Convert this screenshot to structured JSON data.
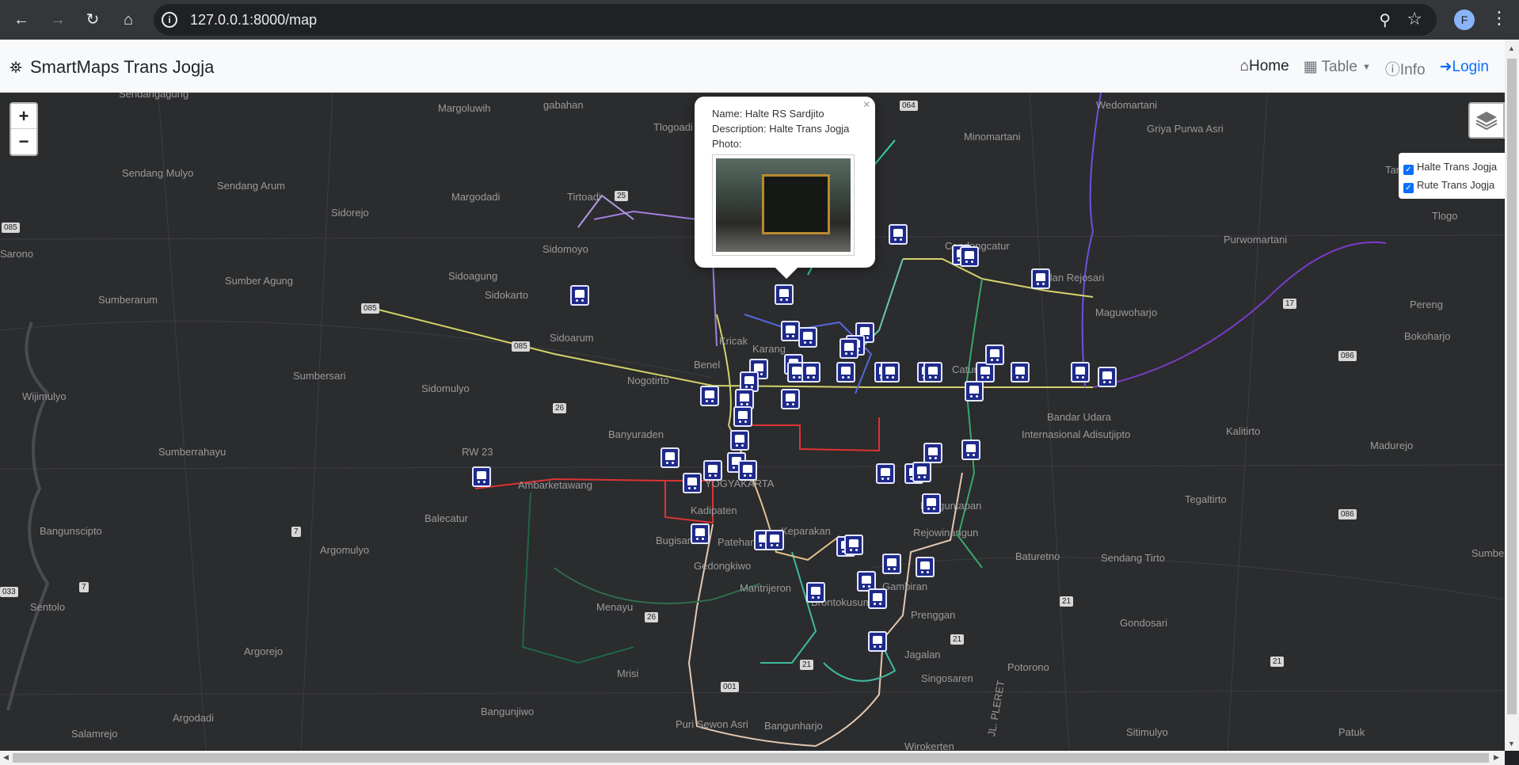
{
  "browser": {
    "url": "127.0.0.1:8000/map",
    "profile_initial": "F"
  },
  "app": {
    "brand": "SmartMaps Trans Jogja",
    "nav": {
      "home": "Home",
      "table": "Table",
      "info": "Info",
      "login": "Login"
    }
  },
  "map": {
    "zoom_in": "+",
    "zoom_out": "−",
    "layers": {
      "halte": "Halte Trans Jogja",
      "rute": "Rute Trans Jogja"
    },
    "popup": {
      "name": "Name: Halte RS Sardjito",
      "description": "Description: Halte Trans Jogja",
      "photo": "Photo:",
      "close": "×"
    },
    "places": [
      "Sendangagung",
      "Margoluwih",
      "gabahan",
      "Tlogoadi",
      "Wedomartani",
      "Griya Purwa Asri",
      "Minomartani",
      "Sendang Mulyo",
      "Sendang Arum",
      "Sidorejo",
      "Margodadi",
      "Tirtoadi",
      "Tamanmartani",
      "Sarono",
      "Sumber Agung",
      "Sidomoyo",
      "Sidoagung",
      "Condongcatur",
      "Purwomartani",
      "Tlogo",
      "Sumberarum",
      "Sidokarto",
      "Sidoarum",
      "Kricak",
      "Karang",
      "Jalan Rejosari",
      "Maguwoharjo",
      "Pereng",
      "Bokoharjo",
      "Sumbersari",
      "Sidomulyo",
      "Benel",
      "Nogotirto",
      "Catur",
      "Wijimulyo",
      "Bandar Udara",
      "Internasional Adisutjipto",
      "Banyuraden",
      "Kalitirto",
      "Madurejo",
      "Sumberrahayu",
      "RW 23",
      "Ambarketawang",
      "YOGYAKARTA",
      "Kadipaten",
      "Banguntapan",
      "Tegaltirto",
      "Bangunscipto",
      "Balecatur",
      "Bugisan",
      "Patehan",
      "Keparakan",
      "Rejowinangun",
      "Baturetno",
      "Sendang Tirto",
      "Argomulyo",
      "Gedongkiwo",
      "Sumber",
      "Sentolo",
      "Mantrijeron",
      "Gambiran",
      "Menayu",
      "Brontokusuman",
      "Prenggan",
      "Gondosari",
      "Argorejo",
      "Jagalan",
      "Potorono",
      "Mrisi",
      "Singosaren",
      "Argodadi",
      "Bangunjiwo",
      "Puri Sewon Asri",
      "Bangunharjo",
      "Sitimulyo",
      "Patuk",
      "Salamrejo",
      "Wirokerten",
      "JL. PLERET"
    ],
    "road_shields": [
      "085",
      "085",
      "085",
      "25",
      "26",
      "7",
      "7",
      "033",
      "26",
      "21",
      "21",
      "21",
      "21",
      "001",
      "086",
      "086",
      "17",
      "064"
    ]
  }
}
